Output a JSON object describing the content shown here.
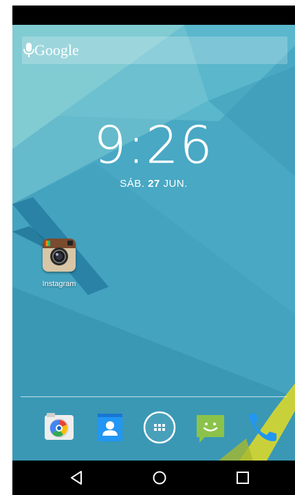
{
  "search": {
    "label": "Google"
  },
  "clock": {
    "time": "9:26"
  },
  "date": {
    "weekday": "SÁB.",
    "day": "27",
    "month": "JUN."
  },
  "desktop": {
    "apps": [
      {
        "label": "Instagram"
      }
    ]
  },
  "dock": {
    "icons": [
      "camera-icon",
      "contacts-icon",
      "app-drawer-icon",
      "messaging-icon",
      "phone-icon"
    ]
  },
  "nav": {
    "icons": [
      "back-icon",
      "home-icon",
      "recents-icon"
    ]
  }
}
